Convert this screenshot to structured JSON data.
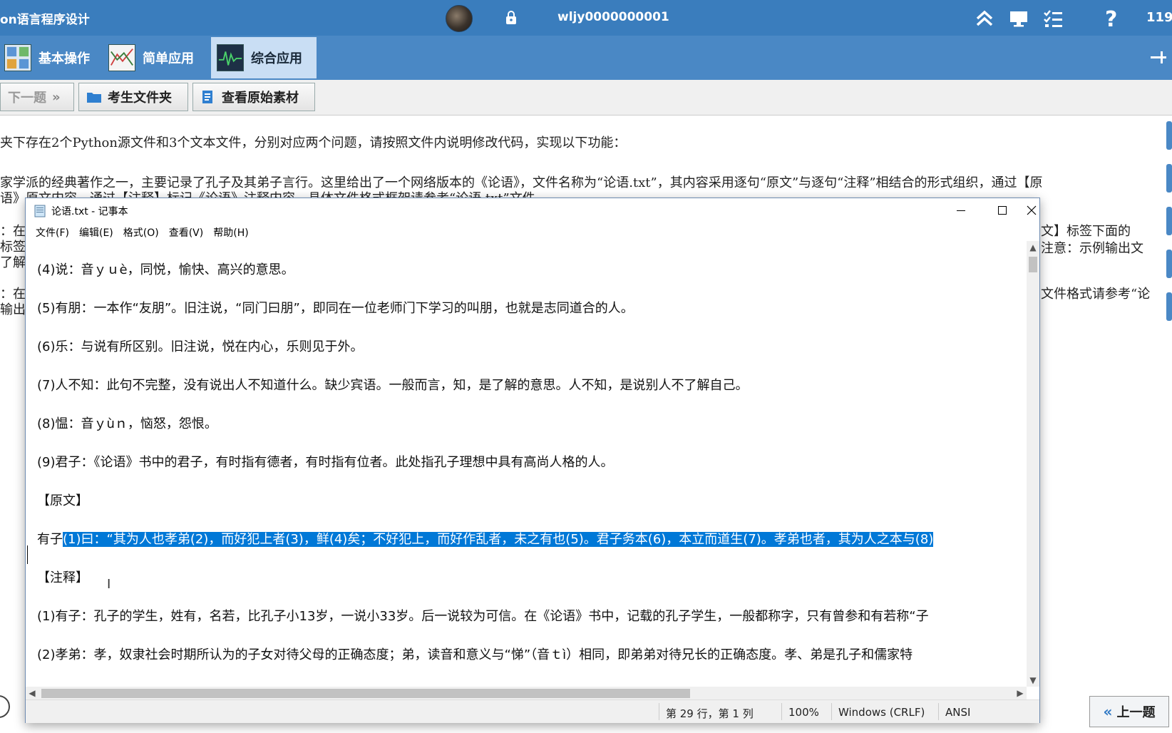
{
  "app": {
    "title": "on语言程序设计",
    "user": "wljy0000000001",
    "counter": "119"
  },
  "tabs": [
    {
      "label": "基本操作",
      "active": false
    },
    {
      "label": "简单应用",
      "active": false
    },
    {
      "label": "综合应用",
      "active": true
    }
  ],
  "toolbar": {
    "next_label": "下一题",
    "folder_label": "考生文件夹",
    "material_label": "查看原始素材"
  },
  "exam": {
    "lines": [
      "夹下存在2个Python源文件和3个文本文件，分别对应两个问题，请按照文件内说明修改代码，实现以下功能：",
      "家学派的经典著作之一，主要记录了孔子及其弟子言行。这里给出了一个网络版本的《论语》，文件名称为“论语.txt”，其内容采用逐句“原文”与逐句“注释”相结合的形式组织，通过【原",
      "语》原文内容，通过【注释】标记《论语》注释内容，具体文件格式框架请参考“论语.txt”文件。",
      "：在",
      "标签",
      "了解",
      "：在",
      "输出"
    ],
    "right_fragments": [
      "文】标签下面的",
      "注意：示例输出文",
      "文件格式请参考“论"
    ],
    "prev_label": "上一题"
  },
  "notepad": {
    "title": "论语.txt - 记事本",
    "menu": [
      "文件(F)",
      "编辑(E)",
      "格式(O)",
      "查看(V)",
      "帮助(H)"
    ],
    "lines": [
      "(4)说：音ｙｕè，同悦，愉快、高兴的意思。",
      "(5)有朋：一本作“友朋”。旧注说，“同门曰朋”，即同在一位老师门下学习的叫朋，也就是志同道合的人。",
      "(6)乐：与说有所区别。旧注说，悦在内心，乐则见于外。",
      "(7)人不知：此句不完整，没有说出人不知道什么。缺少宾语。一般而言，知，是了解的意思。人不知，是说别人不了解自己。",
      "(8)愠：音ｙùｎ，恼怒，怨恨。",
      "(9)君子：《论语》书中的君子，有时指有德者，有时指有位者。此处指孔子理想中具有高尚人格的人。",
      "【原文】",
      "【注释】",
      "(1)有子：孔子的学生，姓有，名若，比孔子小13岁，一说小33岁。后一说较为可信。在《论语》书中，记载的孔子学生，一般都称字，只有曾参和有若称“子",
      "(2)孝弟：孝，奴隶社会时期所认为的子女对待父母的正确态度；弟，读音和意义与“悌”（音ｔì）相同，即弟弟对待兄长的正确态度。孝、弟是孔子和儒家特"
    ],
    "sel_prefix": "有子",
    "sel_text": "(1)曰：“其为人也孝弟(2)，而好犯上者(3)，鲜(4)矣；不好犯上，而好作乱者，未之有也(5)。君子务本(6)，本立而道生(7)。孝弟也者，其为人之本与(8)",
    "status": {
      "position": "第 29 行，第 1 列",
      "zoom": "100%",
      "line_ending": "Windows (CRLF)",
      "encoding": "ANSI"
    }
  }
}
